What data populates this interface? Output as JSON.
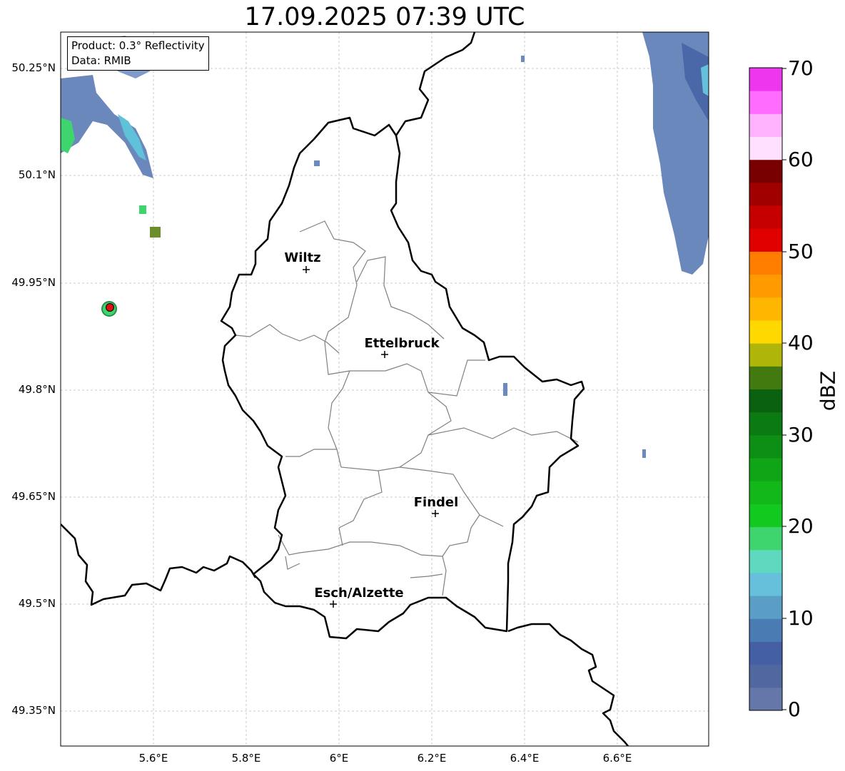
{
  "map": {
    "title": "17.09.2025 07:39 UTC",
    "info": {
      "product": "Product: 0.3° Reflectivity",
      "data": "Data: RMIB"
    },
    "lat_ticks": [
      "50.25°N",
      "50.1°N",
      "49.95°N",
      "49.8°N",
      "49.65°N",
      "49.5°N",
      "49.35°N"
    ],
    "lon_ticks": [
      "5.6°E",
      "5.8°E",
      "6°E",
      "6.2°E",
      "6.4°E",
      "6.6°E"
    ],
    "cities": [
      {
        "name": "Wiltz",
        "lon": 5.93,
        "lat": 49.967
      },
      {
        "name": "Ettelbruck",
        "lon": 6.1,
        "lat": 49.848
      },
      {
        "name": "Findel",
        "lon": 6.21,
        "lat": 49.625
      },
      {
        "name": "Esch/Alzette",
        "lon": 5.99,
        "lat": 49.498
      }
    ],
    "radar_site": {
      "lon": 5.505,
      "lat": 49.915,
      "color": "#e01010"
    },
    "bounds": {
      "lon_min": 5.4,
      "lon_max": 6.795,
      "lat_min": 49.3,
      "lat_max": 50.3
    }
  },
  "colorbar": {
    "label": "dBZ",
    "ticks": [
      "0",
      "10",
      "20",
      "30",
      "40",
      "50",
      "60",
      "70"
    ],
    "colors": [
      "#6577a8",
      "#50689f",
      "#445fa3",
      "#4b7bb3",
      "#5a9ec6",
      "#66c0db",
      "#5fd8c0",
      "#3ed46e",
      "#12c91f",
      "#12b819",
      "#10a517",
      "#0d8f16",
      "#0b7a12",
      "#0a6110",
      "#437a10",
      "#b0b50a",
      "#ffd800",
      "#ffb600",
      "#ff9a00",
      "#ff7e00",
      "#e00000",
      "#c60000",
      "#a00000",
      "#780000",
      "#ffe0ff",
      "#ffb3ff",
      "#ff6cff",
      "#ee36ee"
    ]
  }
}
